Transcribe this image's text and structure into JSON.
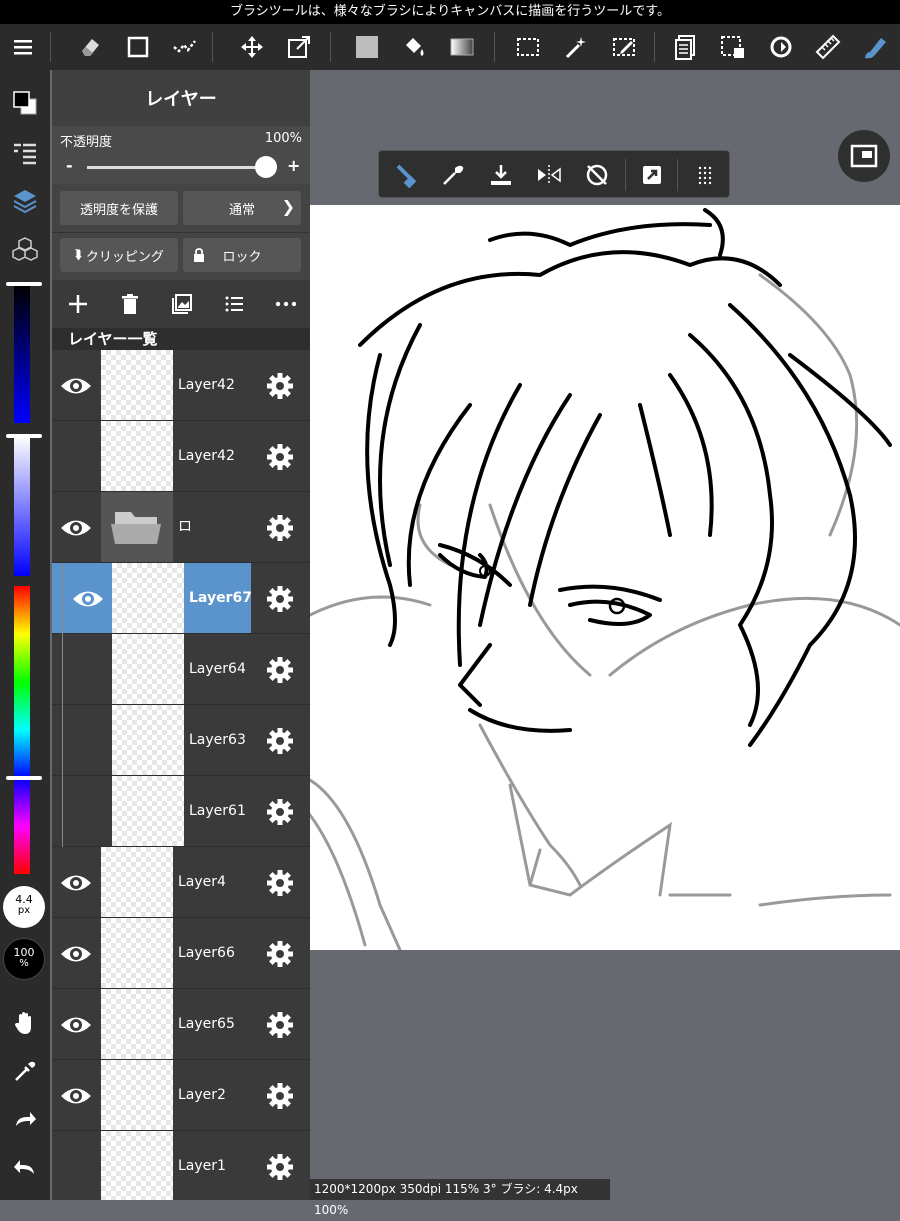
{
  "hint_text": "ブラシツールは、様々なブラシによりキャンバスに描画を行うツールです。",
  "toolbar": {
    "icons": [
      "menu-icon",
      "eraser-icon",
      "rect-shape-icon",
      "stroke-icon",
      "move-icon",
      "transform-icon",
      "fill-color-icon",
      "bucket-icon",
      "gradient-icon",
      "select-rect-icon",
      "magic-wand-icon",
      "select-pen-icon",
      "copy-icon",
      "select-deselect-icon",
      "rotate-icon",
      "ruler-icon",
      "brush-icon"
    ]
  },
  "panel": {
    "title": "レイヤー",
    "opacity_label": "不透明度",
    "opacity_value": "100%",
    "opacity_fraction": 1.0,
    "minus": "-",
    "plus": "+",
    "protect_label": "透明度を保護",
    "blend_label": "通常",
    "clipping_label": "クリッピング",
    "lock_label": "ロック",
    "list_title": "レイヤー一覧"
  },
  "layers": [
    {
      "name": "Layer42",
      "visible": true,
      "selected": false,
      "indent": false,
      "folder": false
    },
    {
      "name": "Layer42",
      "visible": false,
      "selected": false,
      "indent": false,
      "folder": false
    },
    {
      "name": "ロ",
      "visible": true,
      "selected": false,
      "indent": false,
      "folder": true
    },
    {
      "name": "Layer67",
      "visible": true,
      "selected": true,
      "indent": true,
      "folder": false
    },
    {
      "name": "Layer64",
      "visible": false,
      "selected": false,
      "indent": true,
      "folder": false
    },
    {
      "name": "Layer63",
      "visible": false,
      "selected": false,
      "indent": true,
      "folder": false
    },
    {
      "name": "Layer61",
      "visible": false,
      "selected": false,
      "indent": true,
      "folder": false
    },
    {
      "name": "Layer4",
      "visible": true,
      "selected": false,
      "indent": false,
      "folder": false
    },
    {
      "name": "Layer66",
      "visible": true,
      "selected": false,
      "indent": false,
      "folder": false
    },
    {
      "name": "Layer65",
      "visible": true,
      "selected": false,
      "indent": false,
      "folder": false
    },
    {
      "name": "Layer2",
      "visible": true,
      "selected": false,
      "indent": false,
      "folder": false
    },
    {
      "name": "Layer1",
      "visible": false,
      "selected": false,
      "indent": false,
      "folder": false
    }
  ],
  "brush": {
    "size_value": "4.4",
    "size_unit": "px",
    "opacity_value": "100",
    "opacity_unit": "%"
  },
  "status_text": "1200*1200px 350dpi 115% 3° ブラシ: 4.4px 100%",
  "colors": {
    "accent": "#5b93cc",
    "panel": "#3a3a3a",
    "canvas_bg": "#666a70"
  }
}
